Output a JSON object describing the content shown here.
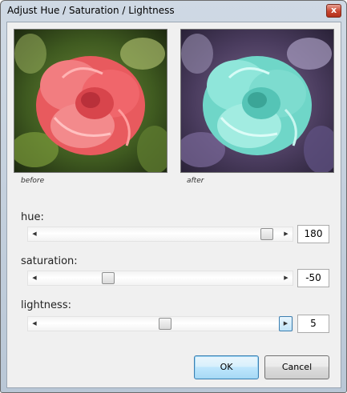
{
  "window": {
    "title": "Adjust Hue / Saturation / Lightness",
    "close_glyph": "x"
  },
  "previews": {
    "before_caption": "before",
    "after_caption": "after"
  },
  "sliders": [
    {
      "label": "hue:",
      "value": "180",
      "fraction": 0.97
    },
    {
      "label": "saturation:",
      "value": "-50",
      "fraction": 0.27
    },
    {
      "label": "lightness:",
      "value": "5",
      "fraction": 0.52
    }
  ],
  "arrows": {
    "left": "◀",
    "right": "▶"
  },
  "buttons": {
    "ok": "OK",
    "cancel": "Cancel"
  },
  "colors": {
    "before_petal": "#f26a6e",
    "after_petal": "#7fe0d3"
  }
}
